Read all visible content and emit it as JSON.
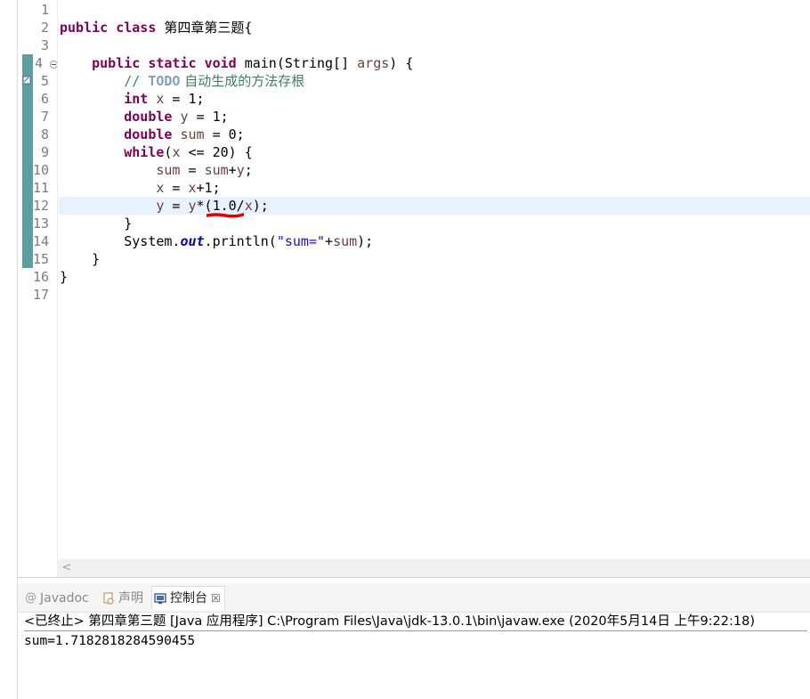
{
  "editor": {
    "line_numbers": [
      "1",
      "2",
      "3",
      "4",
      "5",
      "6",
      "7",
      "8",
      "9",
      "10",
      "11",
      "12",
      "13",
      "14",
      "15",
      "16",
      "17"
    ],
    "code": {
      "l2": {
        "kw1": "public",
        "kw2": "class",
        "name": "第四章第三题",
        "brace": "{"
      },
      "l4": {
        "kw1": "public",
        "kw2": "static",
        "kw3": "void",
        "rest1": "main(String[] ",
        "param": "args",
        "rest2": ") {"
      },
      "l5": {
        "slashes": "// ",
        "todo": "TODO",
        "text": " 自动生成的方法存根"
      },
      "l6": {
        "kw": "int",
        "var": "x",
        "rest": " = 1;"
      },
      "l7": {
        "kw": "double",
        "var": "y",
        "rest": " = 1;"
      },
      "l8": {
        "kw": "double",
        "var": "sum",
        "rest": " = 0;"
      },
      "l9": {
        "kw": "while",
        "rest1": "(",
        "var": "x",
        "rest2": " <= 20) {"
      },
      "l10": {
        "v1": "sum",
        "op": " = ",
        "v2": "sum",
        "plus": "+",
        "v3": "y",
        "end": ";"
      },
      "l11": {
        "v1": "x",
        "op": " = ",
        "v2": "x",
        "rest": "+1;"
      },
      "l12": {
        "v1": "y",
        "op": " = ",
        "v2": "y",
        "mid": "*(1.0/",
        "v3": "x",
        "end": ");"
      },
      "l13": "}",
      "l14": {
        "pre": "System.",
        "field": "out",
        "mid": ".println(",
        "str": "\"sum=\"",
        "plus": "+",
        "var": "sum",
        "end": ");"
      },
      "l15": "}",
      "l16": "}"
    },
    "scroll_left_glyph": "<"
  },
  "console": {
    "tabs": [
      {
        "icon": "@",
        "label": "Javadoc"
      },
      {
        "icon": "",
        "label": "声明"
      },
      {
        "icon": "",
        "label": "控制台",
        "close": "☒"
      }
    ],
    "description": "<已终止> 第四章第三题 [Java 应用程序] C:\\Program Files\\Java\\jdk-13.0.1\\bin\\javaw.exe  (2020年5月14日 上午9:22:18)",
    "output": "sum=1.7182818284590455"
  },
  "colors": {
    "keyword": "#7f0055",
    "variable": "#6a3e3e",
    "comment": "#3f7f5f",
    "todo": "#7f9fbf",
    "string": "#2a00ff",
    "static_field": "#0000c0",
    "current_line": "#e8f2fe",
    "ruler": "#5f9ea0",
    "squiggle": "#e00000"
  }
}
